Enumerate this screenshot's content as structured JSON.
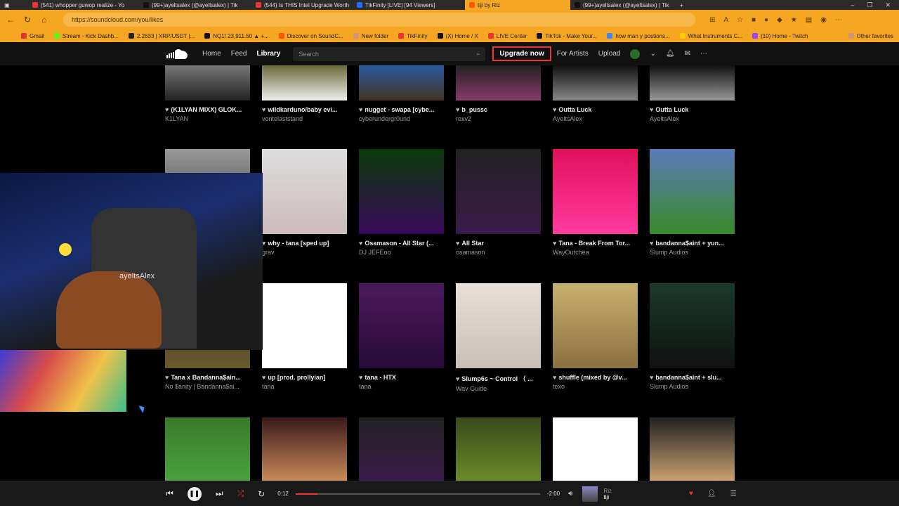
{
  "browser": {
    "tabs": [
      {
        "title": "(541) whopper guwop realize - Yo",
        "color": "#e33"
      },
      {
        "title": "(99+)ayeltsalex (@ayeltsalex) | Tik",
        "color": "#111"
      },
      {
        "title": "(544) Is THIS Intel Upgrade Worth",
        "color": "#e33"
      },
      {
        "title": "TikFinity [LIVE] [94 Viewers]",
        "color": "#1e6fff"
      },
      {
        "title": "tiji by Riz",
        "color": "#f50"
      },
      {
        "title": "(99+)ayeltsalex (@ayeltsalex) | Tik",
        "color": "#111"
      }
    ],
    "url": "https://soundcloud.com/you/likes",
    "bookmarks": [
      {
        "label": "Gmail",
        "color": "#d33"
      },
      {
        "label": "Stream - Kick Dashb...",
        "color": "#53fc18"
      },
      {
        "label": "2.2633 | XRP/USDT |...",
        "color": "#222"
      },
      {
        "label": "NQ1! 23,911.50 ▲ +...",
        "color": "#111"
      },
      {
        "label": "Discover on SoundC...",
        "color": "#f50"
      },
      {
        "label": "New folder",
        "color": "#c97"
      },
      {
        "label": "TikFinity",
        "color": "#e33"
      },
      {
        "label": "(X) Home / X",
        "color": "#111"
      },
      {
        "label": "LIVE Center",
        "color": "#e33"
      },
      {
        "label": "TikTok - Make Your...",
        "color": "#111"
      },
      {
        "label": "how man y postions...",
        "color": "#4285f4"
      },
      {
        "label": "What Instruments C...",
        "color": "#fc0"
      },
      {
        "label": "(10) Home - Twitch",
        "color": "#9146ff"
      }
    ],
    "other_favorites": "Other favorites"
  },
  "soundcloud": {
    "nav": {
      "home": "Home",
      "feed": "Feed",
      "library": "Library"
    },
    "search_placeholder": "Search",
    "upgrade": "Upgrade now",
    "for_artists": "For Artists",
    "upload": "Upload"
  },
  "tracks": [
    {
      "title": "(K1LYAN MIXX) GLOK...",
      "artist": "K1LYAN",
      "art": "linear-gradient(#777,#222)"
    },
    {
      "title": "wildkarduno/baby evi...",
      "artist": "vontelaststand",
      "art": "linear-gradient(#6a6a3a,#eee)"
    },
    {
      "title": "nugget - swapa [cybe...",
      "artist": "cyberundergr0und",
      "art": "linear-gradient(#2a5aa0,#443322)"
    },
    {
      "title": "b_pussc",
      "artist": "rexv2",
      "art": "linear-gradient(#222,#8a3a6a)"
    },
    {
      "title": "Outta Luck",
      "artist": "AyeltsAlex",
      "art": "linear-gradient(#111,#888)"
    },
    {
      "title": "Outta Luck",
      "artist": "AyeltsAlex",
      "art": "linear-gradient(#111,#999)"
    },
    {
      "title": "",
      "artist": "",
      "art": "linear-gradient(#999,#333)"
    },
    {
      "title": "why - tana [sped up]",
      "artist": "grav",
      "art": "linear-gradient(#ddd,#cbb)"
    },
    {
      "title": "Osamason - All Star (...",
      "artist": "DJ JEFEoo",
      "art": "linear-gradient(#0a3a0a,#3a0a5a)"
    },
    {
      "title": "All Star",
      "artist": "osamason",
      "art": "linear-gradient(#222,#3a1a4a)"
    },
    {
      "title": "Tana - Break From Tor...",
      "artist": "WayOutchea",
      "art": "linear-gradient(#e0105a,#ff3aa0)"
    },
    {
      "title": "bandanna$aint + yun...",
      "artist": "Slump Audios",
      "art": "linear-gradient(#5a7aba,#3a8a2a)"
    },
    {
      "title": "Tana x Bandanna$ain...",
      "artist": "No $anity | Bandanna$ai...",
      "art": "linear-gradient(#333,#6a5a2a)"
    },
    {
      "title": "up [prod. prollyian]",
      "artist": "tana",
      "art": "#fff"
    },
    {
      "title": "tana - HTX",
      "artist": "tana",
      "art": "linear-gradient(#4a1a5a,#2a0a3a)"
    },
    {
      "title": "Slump6s ~ Control （ ...",
      "artist": "Wav Guide",
      "art": "linear-gradient(#e8e0d8,#c8c0b8)"
    },
    {
      "title": "shuffle (mixed by @v...",
      "artist": "texo",
      "art": "linear-gradient(#c8b070,#8a7040)"
    },
    {
      "title": "bandanna$aint + slu...",
      "artist": "Slump Audios",
      "art": "linear-gradient(#1a3a2a,#111)"
    },
    {
      "title": "",
      "artist": "",
      "art": "linear-gradient(#3a7a2a,#4aa040)"
    },
    {
      "title": "",
      "artist": "",
      "art": "linear-gradient(#3a1a1a,#c88a5a)"
    },
    {
      "title": "",
      "artist": "",
      "art": "linear-gradient(#222,#3a1a4a)"
    },
    {
      "title": "",
      "artist": "",
      "art": "linear-gradient(#3a4a1a,#6a8a2a)"
    },
    {
      "title": "",
      "artist": "",
      "art": "#fff"
    },
    {
      "title": "",
      "artist": "",
      "art": "linear-gradient(#222,#c8a070)"
    }
  ],
  "webcam": {
    "label": "ayeltsAlex"
  },
  "player": {
    "elapsed": "0:12",
    "remaining": "-2:00",
    "progress": 0.09,
    "track": "tiji",
    "artist": "Riz"
  }
}
